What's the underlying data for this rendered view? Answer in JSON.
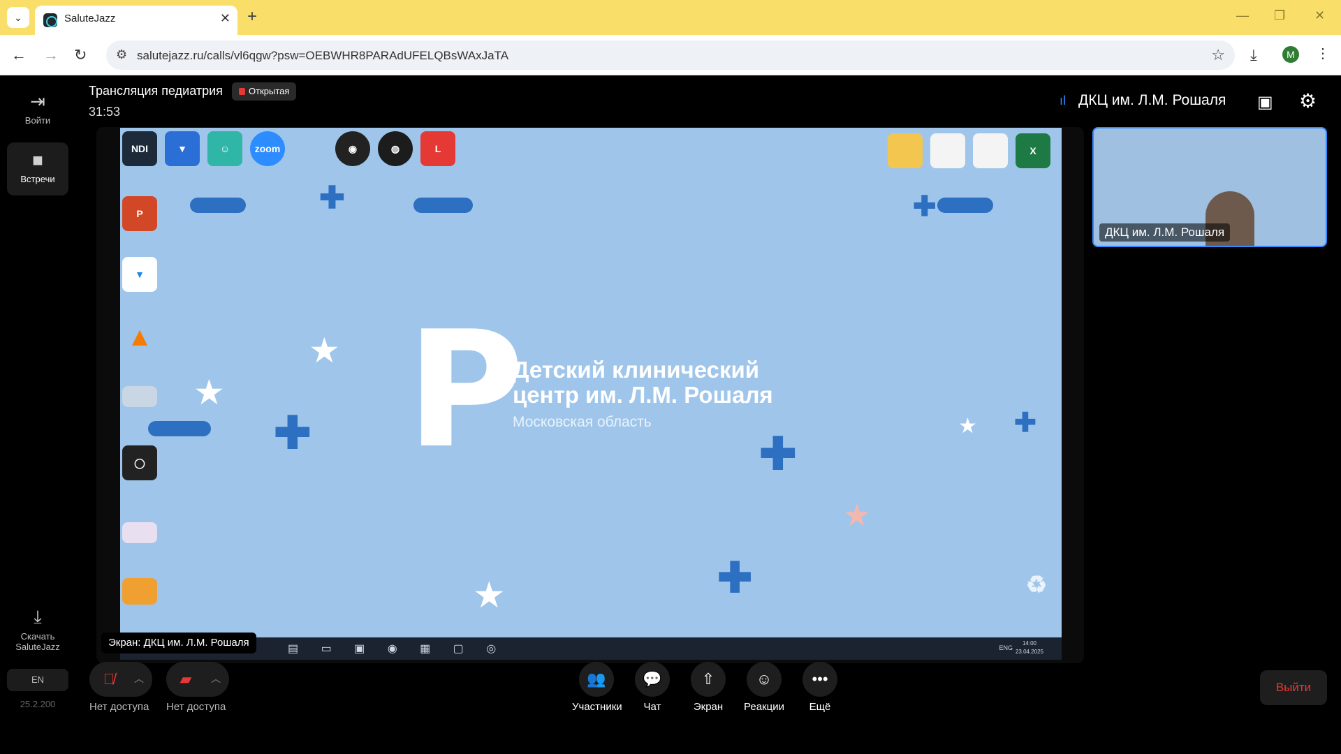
{
  "browser": {
    "tab_title": "SaluteJazz",
    "url": "salutejazz.ru/calls/vl6qgw?psw=OEBWHR8PARAdUFELQBsWAxJaTA",
    "profile_initial": "M"
  },
  "sidebar": {
    "items": [
      {
        "label": "Войти"
      },
      {
        "label": "Встречи"
      },
      {
        "label": "Скачать SaluteJazz"
      }
    ],
    "language": "EN",
    "version": "25.2.200"
  },
  "call": {
    "title": "Трансляция педиатрия",
    "access_badge": "Открытая",
    "timer": "31:53",
    "active_speaker": "ДКЦ им. Л.М. Рошаля"
  },
  "shared_screen": {
    "label": "Экран: ДКЦ им. Л.М. Рошаля",
    "org_line1": "Детский клинический",
    "org_line2": "центр им. Л.М. Рошаля",
    "org_region": "Московская область",
    "desktop_icons_top": [
      {
        "name": "NDI",
        "color": "#1d2a3a"
      },
      {
        "name": "VLC",
        "color": "#2b6fd6"
      },
      {
        "name": "",
        "color": "#2fb6a6"
      },
      {
        "name": "zoom",
        "color": "#2d8cff"
      },
      {
        "name": "",
        "color": "#222222"
      },
      {
        "name": "",
        "color": "#1c1c1c"
      },
      {
        "name": "",
        "color": "#e53935"
      }
    ],
    "clock_time": "14:00",
    "clock_date": "23.04.2025",
    "tray_lang": "ENG"
  },
  "participant": {
    "name": "ДКЦ им. Л.М. Рошаля"
  },
  "controls": {
    "mic_caption": "Нет доступа",
    "cam_caption": "Нет доступа",
    "actions": [
      {
        "label": "Участники",
        "icon": "participants-icon"
      },
      {
        "label": "Чат",
        "icon": "chat-icon"
      },
      {
        "label": "Экран",
        "icon": "screen-share-icon"
      },
      {
        "label": "Реакции",
        "icon": "reactions-icon"
      },
      {
        "label": "Ещё",
        "icon": "more-icon"
      }
    ],
    "leave_label": "Выйти"
  },
  "colors": {
    "accent": "#2f8cff",
    "danger": "#e53935",
    "tab_bar": "#f9df6a",
    "desktop_bg": "#9fc6ea"
  }
}
